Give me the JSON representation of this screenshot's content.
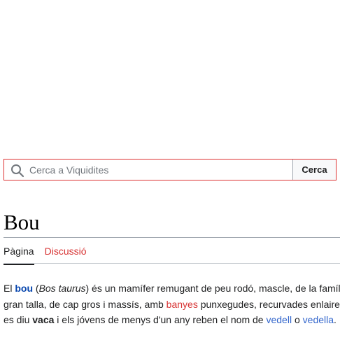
{
  "search": {
    "placeholder": "Cerca a Viquidites",
    "value": "",
    "button_label": "Cerca",
    "icon": "search-icon"
  },
  "page": {
    "title": "Bou"
  },
  "tabs": [
    {
      "label": "Pàgina",
      "active": true
    },
    {
      "label": "Discussió",
      "active": false,
      "color": "#d73333"
    }
  ],
  "article": {
    "line1": {
      "t1": "El ",
      "bou": "bou",
      "t2": " (",
      "latin": "Bos taurus",
      "t3": ") és un mamífer remugant de peu rodó, mascle, de la famíl"
    },
    "line2": {
      "t1": "gran talla, de cap gros i massís, amb ",
      "banyes": "banyes",
      "t2": " punxegudes, recurvades enlaire"
    },
    "line3": {
      "t1": "es diu ",
      "vaca": "vaca",
      "t2": " i els jóvens de menys d'un any reben el nom de ",
      "vedell": "vedell",
      "t3": " o ",
      "vedella": "vedella",
      "t4": "."
    }
  },
  "colors": {
    "search_border": "#dd3333",
    "link_blue": "#3366cc",
    "link_red": "#d73333"
  }
}
